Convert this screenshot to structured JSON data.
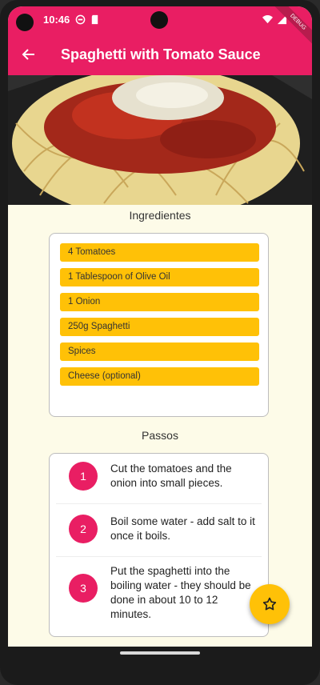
{
  "status_bar": {
    "time": "10:46"
  },
  "app_bar": {
    "title": "Spaghetti with Tomato Sauce"
  },
  "ingredients": {
    "title": "Ingredientes",
    "items": [
      "4 Tomatoes",
      "1 Tablespoon of Olive Oil",
      "1 Onion",
      "250g Spaghetti",
      "Spices",
      "Cheese (optional)"
    ]
  },
  "steps": {
    "title": "Passos",
    "items": [
      {
        "number": "1",
        "text": "Cut the tomatoes and the onion into small pieces."
      },
      {
        "number": "2",
        "text": "Boil some water - add salt to it once it boils."
      },
      {
        "number": "3",
        "text": "Put the spaghetti into the boiling water - they should be done in about 10 to 12 minutes."
      }
    ]
  },
  "colors": {
    "primary": "#e91e63",
    "accent": "#ffc107",
    "background": "#fdfbe8"
  },
  "icons": {
    "back": "arrow-back-icon",
    "favorite": "star-outline-icon"
  }
}
